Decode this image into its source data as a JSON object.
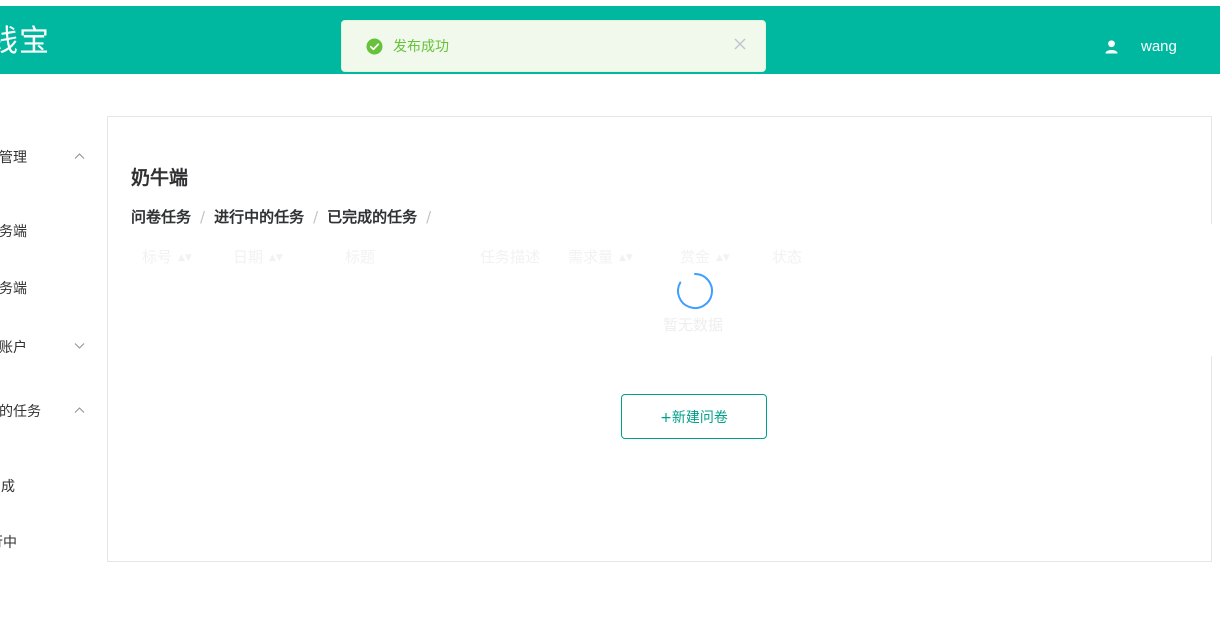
{
  "header": {
    "brand": "钱宝",
    "user_name": "wang"
  },
  "toast": {
    "message": "发布成功",
    "type": "success"
  },
  "sidebar": {
    "items": [
      {
        "label": "管理",
        "arrow": "up"
      },
      {
        "label": "务端"
      },
      {
        "label": "务端"
      },
      {
        "label": "账户",
        "arrow": "down"
      },
      {
        "label": "的任务",
        "arrow": "up"
      },
      {
        "label": "成"
      },
      {
        "label": "行中"
      }
    ]
  },
  "main": {
    "title": "奶牛端",
    "breadcrumb": [
      "问卷任务",
      "进行中的任务",
      "已完成的任务"
    ],
    "table": {
      "columns": [
        {
          "label": "标号",
          "sortable": true
        },
        {
          "label": "日期",
          "sortable": true
        },
        {
          "label": "标题",
          "sortable": false
        },
        {
          "label": "任务描述",
          "sortable": false
        },
        {
          "label": "需求量",
          "sortable": true
        },
        {
          "label": "赏金",
          "sortable": true
        },
        {
          "label": "状态",
          "sortable": false
        }
      ],
      "empty_text": "暂无数据",
      "loading": true
    },
    "new_button_label": "+新建问卷"
  },
  "colors": {
    "header_bg": "#00b7a0",
    "success": "#67c23a",
    "accent": "#00a08a"
  }
}
